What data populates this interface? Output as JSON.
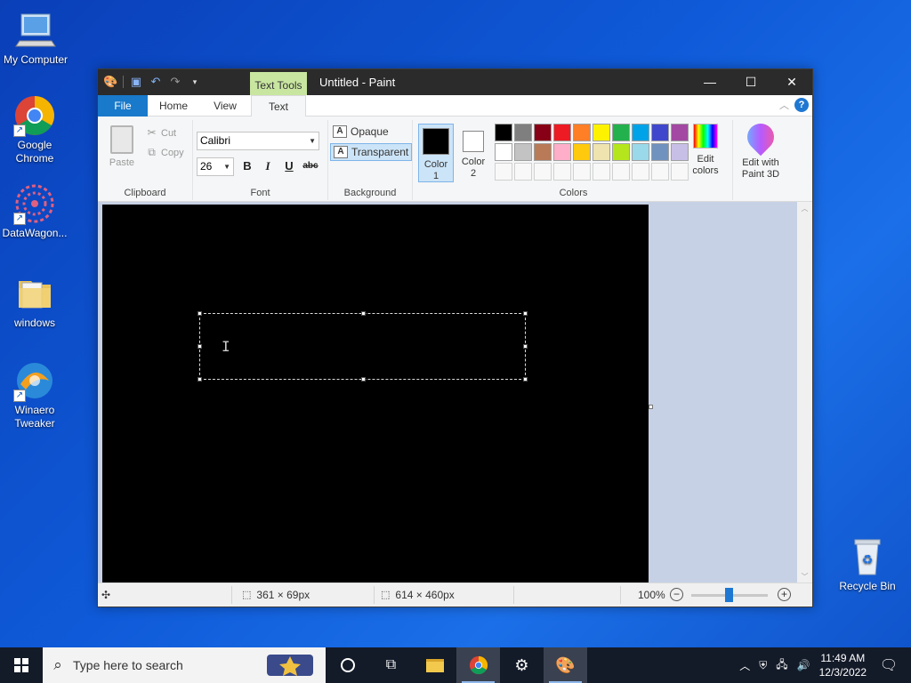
{
  "desktop": {
    "icons": [
      {
        "label": "My Computer"
      },
      {
        "label": "Google Chrome"
      },
      {
        "label": "DataWagon..."
      },
      {
        "label": "windows"
      },
      {
        "label": "Winaero Tweaker"
      },
      {
        "label": "Recycle Bin"
      }
    ]
  },
  "window": {
    "title": "Untitled - Paint",
    "context_tab": "Text Tools",
    "tabs": [
      "File",
      "Home",
      "View",
      "Text"
    ],
    "active_tab": "Text"
  },
  "ribbon": {
    "clipboard": {
      "label": "Clipboard",
      "paste": "Paste",
      "cut": "Cut",
      "copy": "Copy"
    },
    "font": {
      "label": "Font",
      "family": "Calibri",
      "size": "26",
      "bold": "B",
      "italic": "I",
      "underline": "U",
      "strike": "abc"
    },
    "background": {
      "label": "Background",
      "opaque": "Opaque",
      "transparent": "Transparent",
      "selected": "Transparent"
    },
    "colors": {
      "label": "Colors",
      "color1_label": "Color 1",
      "color2_label": "Color 2",
      "color1": "#000000",
      "color2": "#ffffff",
      "edit_colors": "Edit colors",
      "palette_row1": [
        "#000000",
        "#7f7f7f",
        "#880015",
        "#ed1c24",
        "#ff7f27",
        "#fff200",
        "#22b14c",
        "#00a2e8",
        "#3f48cc",
        "#a349a4"
      ],
      "palette_row2": [
        "#ffffff",
        "#c3c3c3",
        "#b97a57",
        "#ffaec9",
        "#ffc90e",
        "#efe4b0",
        "#b5e61d",
        "#99d9ea",
        "#7092be",
        "#c8bfe7"
      ],
      "palette_row3_count": 10
    },
    "paint3d": "Edit with Paint 3D"
  },
  "status": {
    "selection_size": "361 × 69px",
    "canvas_size": "614 × 460px",
    "zoom": "100%"
  },
  "taskbar": {
    "search_placeholder": "Type here to search",
    "time": "11:49 AM",
    "date": "12/3/2022"
  }
}
